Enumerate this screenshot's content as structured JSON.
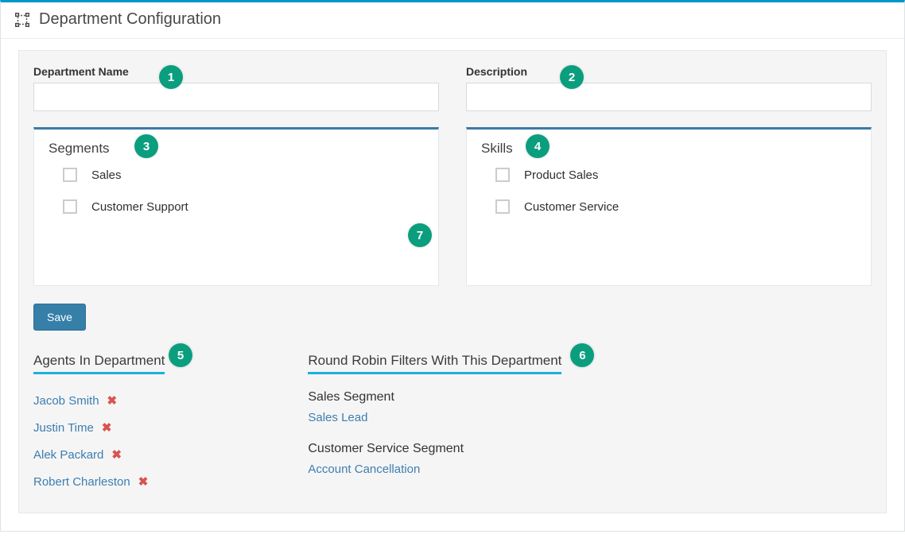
{
  "header": {
    "title": "Department Configuration"
  },
  "form": {
    "dept_name_label": "Department Name",
    "dept_name_value": "",
    "description_label": "Description",
    "description_value": "",
    "save_label": "Save"
  },
  "segments": {
    "title": "Segments",
    "items": [
      {
        "label": "Sales"
      },
      {
        "label": "Customer Support"
      }
    ]
  },
  "skills": {
    "title": "Skills",
    "items": [
      {
        "label": "Product Sales"
      },
      {
        "label": "Customer Service"
      }
    ]
  },
  "agents_section": {
    "title": "Agents In Department",
    "agents": [
      {
        "name": "Jacob Smith"
      },
      {
        "name": "Justin Time"
      },
      {
        "name": "Alek Packard"
      },
      {
        "name": "Robert Charleston"
      }
    ]
  },
  "rr_section": {
    "title": "Round Robin Filters With This Department",
    "groups": [
      {
        "group_title": "Sales Segment",
        "filter": "Sales Lead"
      },
      {
        "group_title": "Customer Service Segment",
        "filter": "Account Cancellation"
      }
    ]
  },
  "badges": {
    "b1": "1",
    "b2": "2",
    "b3": "3",
    "b4": "4",
    "b5": "5",
    "b6": "6",
    "b7": "7"
  }
}
